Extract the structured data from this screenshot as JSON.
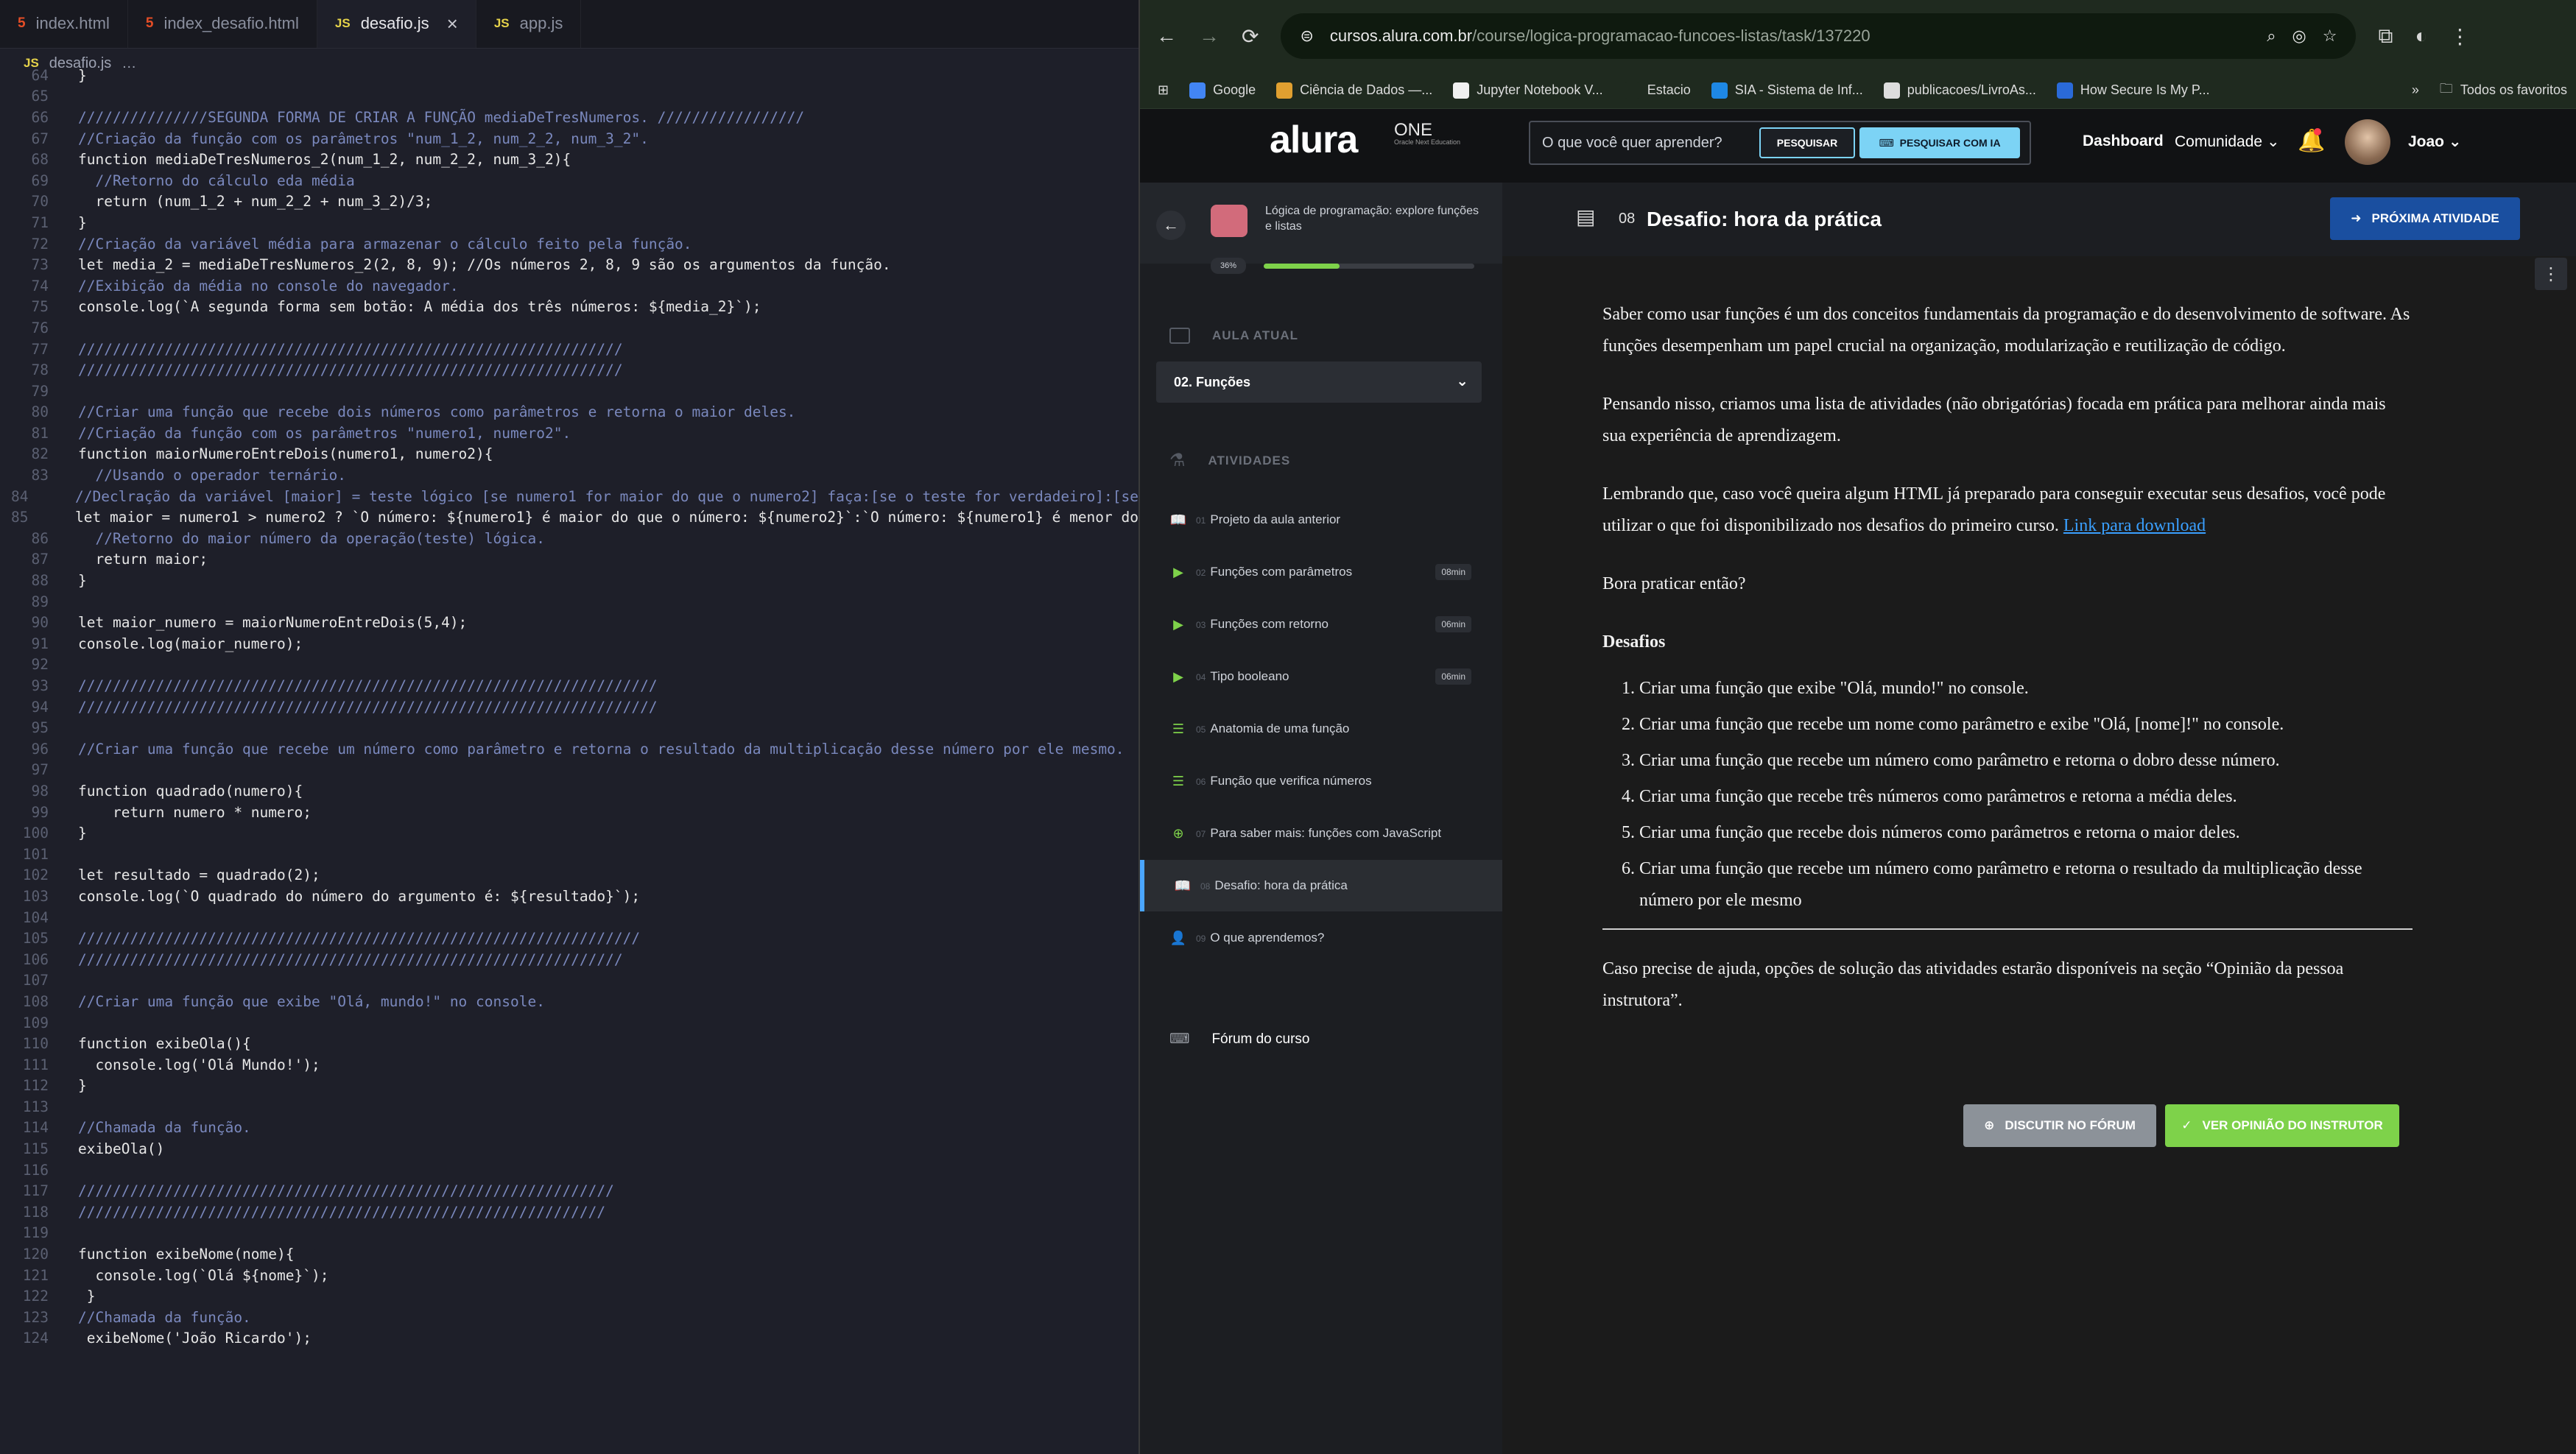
{
  "editor": {
    "tabs": [
      {
        "label": "index.html",
        "type": "html"
      },
      {
        "label": "index_desafio.html",
        "type": "html"
      },
      {
        "label": "desafio.js",
        "type": "js"
      },
      {
        "label": "app.js",
        "type": "js"
      }
    ],
    "breadcrumb": "desafio.js",
    "breadcrumb_more": "…",
    "lines": [
      {
        "n": "64",
        "t": "}"
      },
      {
        "n": "65",
        "t": ""
      },
      {
        "n": "66",
        "t": "///////////////SEGUNDA FORMA DE CRIAR A FUNÇÃO mediaDeTresNumeros. /////////////////"
      },
      {
        "n": "67",
        "t": "//Criação da função com os parâmetros \"num_1_2, num_2_2, num_3_2\"."
      },
      {
        "n": "68",
        "t": "function mediaDeTresNumeros_2(num_1_2, num_2_2, num_3_2){"
      },
      {
        "n": "69",
        "t": "  //Retorno do cálculo eda média"
      },
      {
        "n": "70",
        "t": "  return (num_1_2 + num_2_2 + num_3_2)/3;"
      },
      {
        "n": "71",
        "t": "}"
      },
      {
        "n": "72",
        "t": "//Criação da variável média para armazenar o cálculo feito pela função."
      },
      {
        "n": "73",
        "t": "let media_2 = mediaDeTresNumeros_2(2, 8, 9); //Os números 2, 8, 9 são os argumentos da função."
      },
      {
        "n": "74",
        "t": "//Exibição da média no console do navegador."
      },
      {
        "n": "75",
        "t": "console.log(`A segunda forma sem botão: A média dos três números: ${media_2}`);"
      },
      {
        "n": "76",
        "t": ""
      },
      {
        "n": "77",
        "t": "///////////////////////////////////////////////////////////////"
      },
      {
        "n": "78",
        "t": "///////////////////////////////////////////////////////////////"
      },
      {
        "n": "79",
        "t": ""
      },
      {
        "n": "80",
        "t": "//Criar uma função que recebe dois números como parâmetros e retorna o maior deles."
      },
      {
        "n": "81",
        "t": "//Criação da função com os parâmetros \"numero1, numero2\"."
      },
      {
        "n": "82",
        "t": "function maiorNumeroEntreDois(numero1, numero2){"
      },
      {
        "n": "83",
        "t": "  //Usando o operador ternário."
      },
      {
        "n": "84",
        "t": "  //Declração da variável [maior] = teste lógico [se numero1 for maior do que o numero2] faça:[se o teste for verdadeiro]:[se"
      },
      {
        "n": "85",
        "t": "  let maior = numero1 > numero2 ? `O número: ${numero1} é maior do que o número: ${numero2}`:`O número: ${numero1} é menor do"
      },
      {
        "n": "86",
        "t": "  //Retorno do maior número da operação(teste) lógica."
      },
      {
        "n": "87",
        "t": "  return maior;"
      },
      {
        "n": "88",
        "t": "}"
      },
      {
        "n": "89",
        "t": ""
      },
      {
        "n": "90",
        "t": "let maior_numero = maiorNumeroEntreDois(5,4);"
      },
      {
        "n": "91",
        "t": "console.log(maior_numero);"
      },
      {
        "n": "92",
        "t": ""
      },
      {
        "n": "93",
        "t": "///////////////////////////////////////////////////////////////////"
      },
      {
        "n": "94",
        "t": "///////////////////////////////////////////////////////////////////"
      },
      {
        "n": "95",
        "t": ""
      },
      {
        "n": "96",
        "t": "//Criar uma função que recebe um número como parâmetro e retorna o resultado da multiplicação desse número por ele mesmo."
      },
      {
        "n": "97",
        "t": ""
      },
      {
        "n": "98",
        "t": "function quadrado(numero){"
      },
      {
        "n": "99",
        "t": "    return numero * numero;"
      },
      {
        "n": "100",
        "t": "}"
      },
      {
        "n": "101",
        "t": ""
      },
      {
        "n": "102",
        "t": "let resultado = quadrado(2);"
      },
      {
        "n": "103",
        "t": "console.log(`O quadrado do número do argumento é: ${resultado}`);"
      },
      {
        "n": "104",
        "t": ""
      },
      {
        "n": "105",
        "t": "/////////////////////////////////////////////////////////////////"
      },
      {
        "n": "106",
        "t": "///////////////////////////////////////////////////////////////"
      },
      {
        "n": "107",
        "t": ""
      },
      {
        "n": "108",
        "t": "//Criar uma função que exibe \"Olá, mundo!\" no console."
      },
      {
        "n": "109",
        "t": ""
      },
      {
        "n": "110",
        "t": "function exibeOla(){"
      },
      {
        "n": "111",
        "t": "  console.log('Olá Mundo!');"
      },
      {
        "n": "112",
        "t": "}"
      },
      {
        "n": "113",
        "t": ""
      },
      {
        "n": "114",
        "t": "//Chamada da função."
      },
      {
        "n": "115",
        "t": "exibeOla()"
      },
      {
        "n": "116",
        "t": ""
      },
      {
        "n": "117",
        "t": "//////////////////////////////////////////////////////////////"
      },
      {
        "n": "118",
        "t": "/////////////////////////////////////////////////////////////"
      },
      {
        "n": "119",
        "t": ""
      },
      {
        "n": "120",
        "t": "function exibeNome(nome){"
      },
      {
        "n": "121",
        "t": "  console.log(`Olá ${nome}`);"
      },
      {
        "n": "122",
        "t": " }"
      },
      {
        "n": "123",
        "t": "//Chamada da função."
      },
      {
        "n": "124",
        "t": " exibeNome('João Ricardo');"
      }
    ]
  },
  "browser": {
    "url_host": "cursos.alura.com.br",
    "url_path": "/course/logica-programacao-funcoes-listas/task/137220",
    "bookmarks": [
      {
        "label": "Google",
        "color": "#4285f4"
      },
      {
        "label": "Ciência de Dados —...",
        "color": "#e0a030"
      },
      {
        "label": "Jupyter Notebook V...",
        "color": "#f0f0f0"
      },
      {
        "label": "Estacio",
        "color": "#1f2a1f"
      },
      {
        "label": "SIA - Sistema de Inf...",
        "color": "#1e88e5"
      },
      {
        "label": "publicacoes/LivroAs...",
        "color": "#dddddd"
      },
      {
        "label": "How Secure Is My P...",
        "color": "#2a6ad8"
      }
    ],
    "bookmarks_all": "Todos os favoritos"
  },
  "alura": {
    "logo": "alura",
    "one_label": "ONE",
    "one_sub": "Oracle Next Education",
    "search_placeholder": "O que você quer aprender?",
    "search_btn": "PESQUISAR",
    "search_ia_btn": "PESQUISAR COM IA",
    "dashboard": "Dashboard",
    "comunidade": "Comunidade",
    "user": "Joao"
  },
  "course": {
    "title": "Lógica de programação: explore funções e listas",
    "progress_label": "36%",
    "progress": 0.36,
    "aula_atual_label": "AULA ATUAL",
    "aula_atual": "02. Funções",
    "atividades_label": "ATIVIDADES",
    "items": [
      {
        "num": "01",
        "label": "Projeto da aula anterior",
        "dur": "",
        "icon": "book-icon"
      },
      {
        "num": "02",
        "label": "Funções com parâmetros",
        "dur": "08min",
        "icon": "video-icon"
      },
      {
        "num": "03",
        "label": "Funções com retorno",
        "dur": "06min",
        "icon": "video-icon"
      },
      {
        "num": "04",
        "label": "Tipo booleano",
        "dur": "06min",
        "icon": "video-icon"
      },
      {
        "num": "05",
        "label": "Anatomia de uma função",
        "dur": "",
        "icon": "list-icon"
      },
      {
        "num": "06",
        "label": "Função que verifica números",
        "dur": "",
        "icon": "list-icon"
      },
      {
        "num": "07",
        "label": "Para saber mais: funções com JavaScript",
        "dur": "",
        "icon": "plus-icon"
      },
      {
        "num": "08",
        "label": "Desafio: hora da prática",
        "dur": "",
        "icon": "book-icon",
        "active": true
      },
      {
        "num": "09",
        "label": "O que aprendemos?",
        "dur": "",
        "icon": "user-icon"
      }
    ],
    "forum_label": "Fórum do curso"
  },
  "task": {
    "number": "08",
    "title": "Desafio: hora da prática",
    "next_btn": "PRÓXIMA ATIVIDADE",
    "p1": "Saber como usar funções é um dos conceitos fundamentais da programação e do desenvolvimento de software. As funções desempenham um papel crucial na organização, modularização e reutilização de código.",
    "p2": "Pensando nisso, criamos uma lista de atividades (não obrigatórias) focada em prática para melhorar ainda mais sua experiência de aprendizagem.",
    "p3": "Lembrando que, caso você queira algum HTML já preparado para conseguir executar seus desafios, você pode utilizar o que foi disponibilizado nos desafios do primeiro curso.",
    "p3_link": "Link para download",
    "p4": "Bora praticar então?",
    "desafios_heading": "Desafios",
    "desafios": [
      "Criar uma função que exibe \"Olá, mundo!\" no console.",
      "Criar uma função que recebe um nome como parâmetro e exibe \"Olá, [nome]!\" no console.",
      "Criar uma função que recebe um número como parâmetro e retorna o dobro desse número.",
      "Criar uma função que recebe três números como parâmetros e retorna a média deles.",
      "Criar uma função que recebe dois números como parâmetros e retorna o maior deles.",
      "Criar uma função que recebe um número como parâmetro e retorna o resultado da multiplicação desse número por ele mesmo"
    ],
    "help": "Caso precise de ajuda, opções de solução das atividades estarão disponíveis na seção “Opinião da pessoa instrutora”.",
    "forum_btn": "DISCUTIR NO FÓRUM",
    "opiniao_btn": "VER OPINIÃO DO INSTRUTOR"
  }
}
